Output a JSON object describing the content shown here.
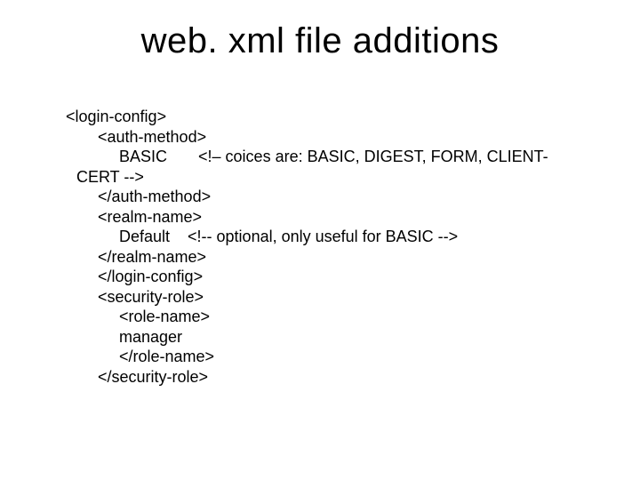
{
  "title": "web. xml file additions",
  "lines": {
    "l1": "<login-config>",
    "l2": "<auth-method>",
    "l3": "BASIC       <!– coices are: BASIC, DIGEST, FORM, CLIENT-",
    "l3b": "CERT -->",
    "l4": "</auth-method>",
    "l5": "<realm-name>",
    "l6": "Default    <!-- optional, only useful for BASIC -->",
    "l7": "</realm-name>",
    "l8": "</login-config>",
    "l9": "<security-role>",
    "l10": "<role-name>",
    "l11": "manager",
    "l12": "</role-name>",
    "l13": "</security-role>"
  }
}
